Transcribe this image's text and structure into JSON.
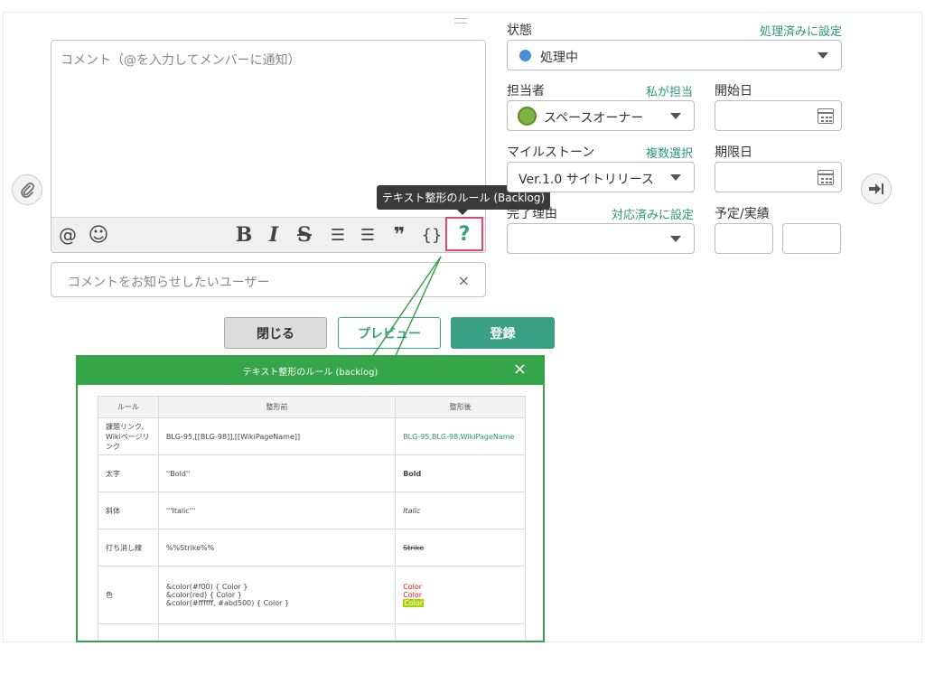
{
  "comment": {
    "placeholder": "コメント（@を入力してメンバーに通知）",
    "notify_placeholder": "コメントをお知らせしたいユーザー",
    "notify_clear": "×"
  },
  "toolbar": {
    "mention": "@",
    "emoji": "☺",
    "bold": "B",
    "italic": "I",
    "strike": "S",
    "ul": "☰",
    "ol": "☰",
    "quote": "❞",
    "code": "{}",
    "help": "?"
  },
  "tooltip": "テキスト整形のルール (Backlog)",
  "buttons": {
    "close": "閉じる",
    "preview": "プレビュー",
    "submit": "登録"
  },
  "form": {
    "status_label": "状態",
    "status_link": "処理済みに設定",
    "status_value": "処理中",
    "status_color": "#4a90d9",
    "assignee_label": "担当者",
    "assignee_link": "私が担当",
    "assignee_value": "スペースオーナー",
    "start_label": "開始日",
    "milestone_label": "マイルストーン",
    "milestone_link": "複数選択",
    "milestone_value": "Ver.1.0 サイトリリース",
    "due_label": "期限日",
    "resolution_label": "完了理由",
    "resolution_link": "対応済みに設定",
    "estimate_label": "予定/実績"
  },
  "popup": {
    "title": "テキスト整形のルール (backlog)",
    "close": "×",
    "headers": [
      "ルール",
      "整形前",
      "整形後"
    ],
    "rows": [
      {
        "rule": "課題リンク、Wikiページリンク",
        "before": "BLG-95,[[BLG-98]],[[WikiPageName]]",
        "after": "BLG-95,BLG-98,WikiPageName"
      },
      {
        "rule": "太字",
        "before": "''Bold''",
        "after": "Bold"
      },
      {
        "rule": "斜体",
        "before": "'''Italic'''",
        "after": "Italic"
      },
      {
        "rule": "打ち消し線",
        "before": "%%Strike%%",
        "after": "Strike"
      },
      {
        "rule": "色",
        "before_lines": [
          "&color(#f00) { Color }",
          "&color(red) { Color }",
          "&color(#ffffff, #abd500) { Color }"
        ],
        "after_lines": [
          "Color",
          "Color",
          "Color"
        ]
      }
    ]
  },
  "colors": {
    "accent": "#3aa084",
    "popup_green": "#35a54a",
    "highlight_pink": "#e0457b"
  }
}
